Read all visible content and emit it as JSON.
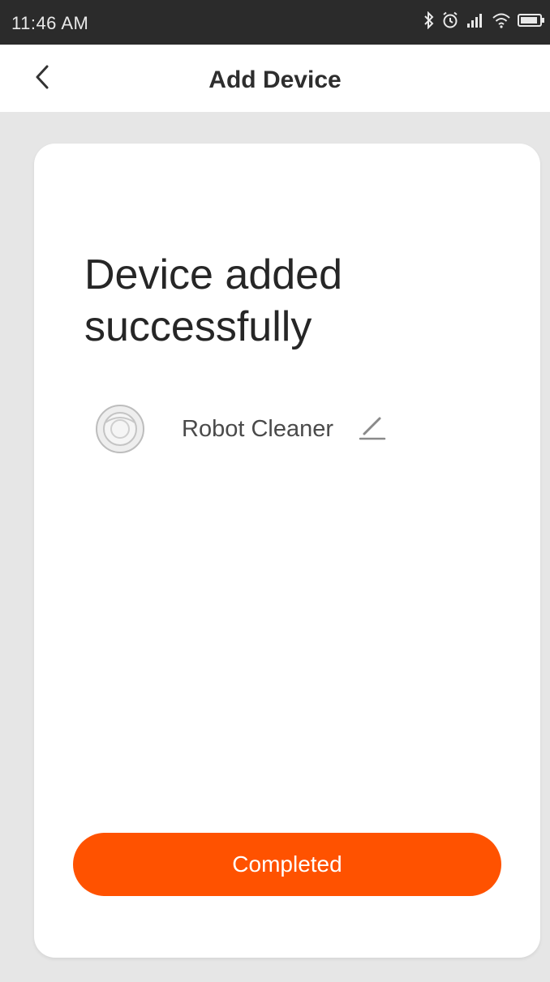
{
  "status_bar": {
    "time": "11:46 AM",
    "icons": [
      "bluetooth-icon",
      "alarm-icon",
      "signal-icon",
      "wifi-icon",
      "battery-icon"
    ]
  },
  "header": {
    "title": "Add Device",
    "back_icon": "chevron-left-icon"
  },
  "main": {
    "success_title": "Device added successfully",
    "device": {
      "name": "Robot Cleaner",
      "icon": "robot-cleaner-icon",
      "edit_icon": "pencil-icon"
    },
    "completed_label": "Completed"
  },
  "colors": {
    "accent": "#ff5200",
    "status_bar": "#2b2b2b",
    "background": "#e6e6e6",
    "card": "#ffffff"
  }
}
